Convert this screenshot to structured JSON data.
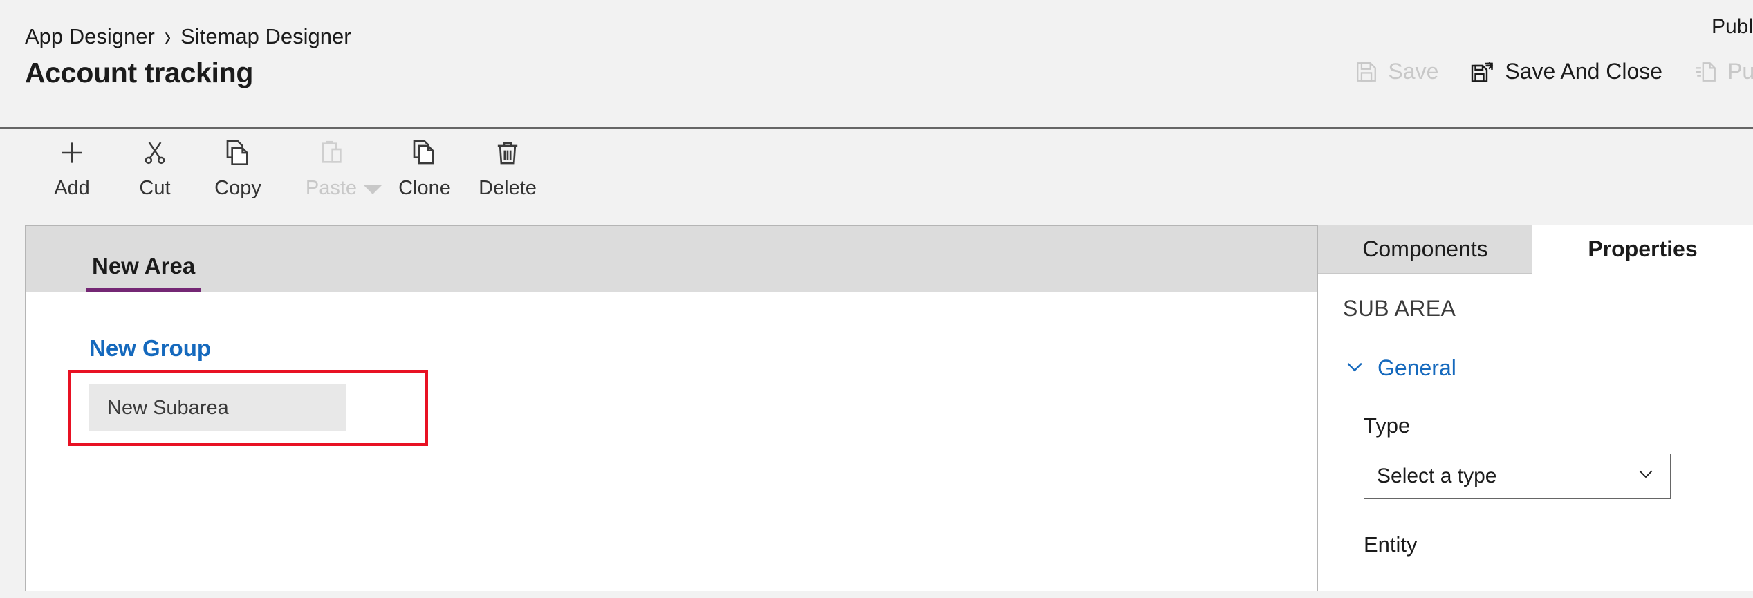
{
  "header": {
    "breadcrumb": [
      {
        "label": "App Designer"
      },
      {
        "label": "Sitemap Designer"
      }
    ],
    "separator": "›",
    "title": "Account tracking",
    "status_text": "Publ",
    "actions": [
      {
        "label": "Save",
        "icon": "save-icon",
        "disabled": true
      },
      {
        "label": "Save And Close",
        "icon": "save-and-close-icon",
        "disabled": false
      },
      {
        "label": "Pub",
        "icon": "publish-icon",
        "disabled": true
      }
    ]
  },
  "commandbar": {
    "commands": [
      {
        "label": "Add",
        "icon": "plus-icon",
        "disabled": false,
        "caret": false
      },
      {
        "label": "Cut",
        "icon": "scissors-icon",
        "disabled": false,
        "caret": false
      },
      {
        "label": "Copy",
        "icon": "copy-icon",
        "disabled": false,
        "caret": false
      },
      {
        "label": "Paste",
        "icon": "clipboard-icon",
        "disabled": true,
        "caret": true
      },
      {
        "label": "Clone",
        "icon": "clone-icon",
        "disabled": false,
        "caret": false
      },
      {
        "label": "Delete",
        "icon": "trash-icon",
        "disabled": false,
        "caret": false
      }
    ]
  },
  "canvas": {
    "area_tab": "New Area",
    "group_title": "New Group",
    "subarea_label": "New Subarea",
    "selection_color": "#e81123",
    "tab_accent_color": "#742774",
    "group_color": "#1569bd"
  },
  "panel": {
    "tabs": [
      {
        "label": "Components",
        "active": false
      },
      {
        "label": "Properties",
        "active": true
      }
    ],
    "section_header": "SUB AREA",
    "general_section": "General",
    "fields": [
      {
        "label": "Type",
        "value": "Select a type",
        "kind": "select"
      },
      {
        "label": "Entity",
        "value": "",
        "kind": "select"
      }
    ]
  }
}
